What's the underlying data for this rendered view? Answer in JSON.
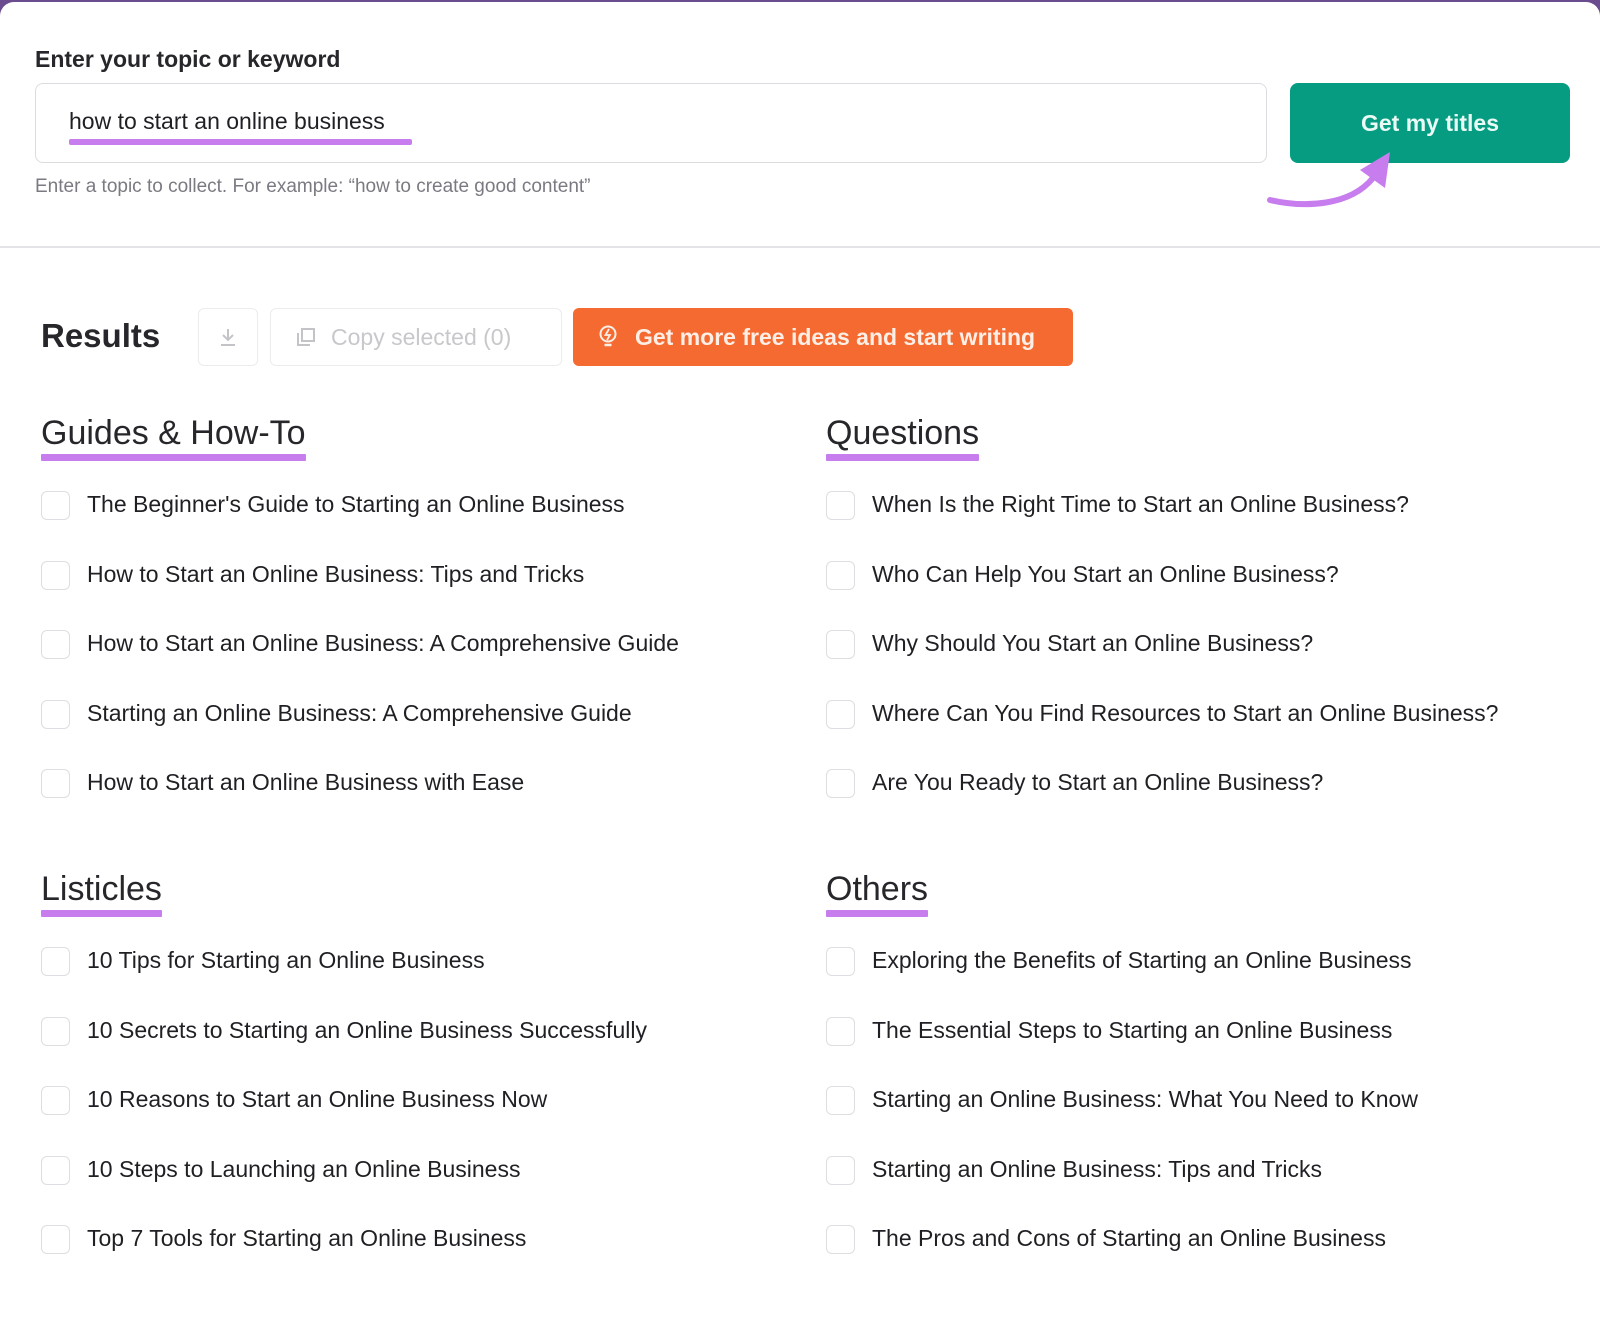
{
  "search": {
    "label": "Enter your topic or keyword",
    "value": "how to start an online business",
    "hint": "Enter a topic to collect. For example: “how to create good content”",
    "submit_label": "Get my titles"
  },
  "colors": {
    "primary_green": "#069c82",
    "accent_orange": "#f56a30",
    "highlight_purple": "#c77dee"
  },
  "results": {
    "title": "Results",
    "download_icon": "download-icon",
    "copy_label": "Copy selected (0)",
    "copy_icon": "copy-icon",
    "more_label": "Get more free ideas and start writing",
    "more_icon": "lightbulb-icon"
  },
  "sections": [
    {
      "title": "Guides & How-To",
      "items": [
        "The Beginner's Guide to Starting an Online Business",
        "How to Start an Online Business: Tips and Tricks",
        "How to Start an Online Business: A Comprehensive Guide",
        "Starting an Online Business: A Comprehensive Guide",
        "How to Start an Online Business with Ease"
      ]
    },
    {
      "title": "Questions",
      "items": [
        "When Is the Right Time to Start an Online Business?",
        "Who Can Help You Start an Online Business?",
        "Why Should You Start an Online Business?",
        "Where Can You Find Resources to Start an Online Business?",
        "Are You Ready to Start an Online Business?"
      ]
    },
    {
      "title": "Listicles",
      "items": [
        "10 Tips for Starting an Online Business",
        "10 Secrets to Starting an Online Business Successfully",
        "10 Reasons to Start an Online Business Now",
        "10 Steps to Launching an Online Business",
        "Top 7 Tools for Starting an Online Business"
      ]
    },
    {
      "title": "Others",
      "items": [
        "Exploring the Benefits of Starting an Online Business",
        "The Essential Steps to Starting an Online Business",
        "Starting an Online Business: What You Need to Know",
        "Starting an Online Business: Tips and Tricks",
        "The Pros and Cons of Starting an Online Business"
      ]
    }
  ]
}
